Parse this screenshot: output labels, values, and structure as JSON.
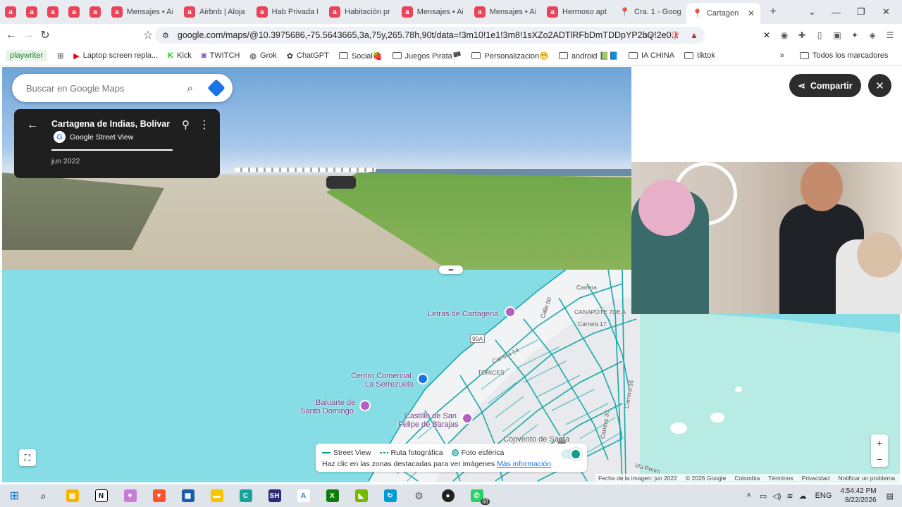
{
  "browser": {
    "tabs": [
      {
        "label": "Mensajes • Ai"
      },
      {
        "label": "Airbnb | Aloja"
      },
      {
        "label": "Hab Privada f"
      },
      {
        "label": "Habitación pr"
      },
      {
        "label": "Mensajes • Ai"
      },
      {
        "label": "Mensajes • Ai"
      },
      {
        "label": "Hermoso apt"
      },
      {
        "label": "Cra. 1 - Goog"
      },
      {
        "label": "Cartagen"
      }
    ],
    "url": "google.com/maps/@10.3975686,-75.5643665,3a,75y,265.78h,90t/data=!3m10!1e1!3m8!1sXZo2ADTlRFbDmTDDpYP2bQ!2e0...",
    "bookmarks": [
      {
        "label": "playwriter"
      },
      {
        "label": "Laptop screen repla..."
      },
      {
        "label": "Kick"
      },
      {
        "label": "TWITCH"
      },
      {
        "label": "Grok"
      },
      {
        "label": "ChatGPT"
      },
      {
        "label": "Social🍓"
      },
      {
        "label": "Juegos Pirata🏴"
      },
      {
        "label": "Personalizacion😁"
      },
      {
        "label": "android 📗📘"
      },
      {
        "label": "IA CHINA"
      },
      {
        "label": "tiktok"
      }
    ],
    "all_bookmarks": "Todos los marcadores",
    "more_bookmarks": "»"
  },
  "maps": {
    "search_placeholder": "Buscar en Google Maps",
    "place_title": "Cartagena de Indias, Bolívar",
    "source": "Google Street View",
    "capture_date": "jun 2022",
    "share_label": "Compartir",
    "legend": {
      "street_view": "Street View",
      "photo_route": "Ruta fotográfica",
      "spherical": "Foto esférica",
      "hint": "Haz clic en las zonas destacadas para ver imágenes",
      "more_info": "Más información"
    },
    "footer": {
      "image_date": "Fecha de la imagen: jun 2022",
      "copyright": "© 2026 Google",
      "country": "Colombia",
      "terms": "Términos",
      "privacy": "Privacidad",
      "report": "Notificar un problema"
    },
    "places": [
      {
        "name": "Letras de Cartagena"
      },
      {
        "name": "Centro Comercial"
      },
      {
        "name": "La Serrezuela"
      },
      {
        "name": "Baluarte de"
      },
      {
        "name": "Santo Domingo"
      },
      {
        "name": "Castillo de San"
      },
      {
        "name": "Felipe de Barajas"
      },
      {
        "name": "Convento de Santa"
      }
    ],
    "streets": [
      "Carrera",
      "CANAPOTE 7DE A",
      "Carrera 17",
      "Calle 60",
      "Carrera 14",
      "TORICES",
      "Carrera 36",
      "Carrera 30",
      "Vía Perim",
      "90A"
    ]
  },
  "taskbar": {
    "time": "4:54:42 PM",
    "date": "8/22/2026",
    "lang": "ENG",
    "whatsapp_badge": "68"
  }
}
